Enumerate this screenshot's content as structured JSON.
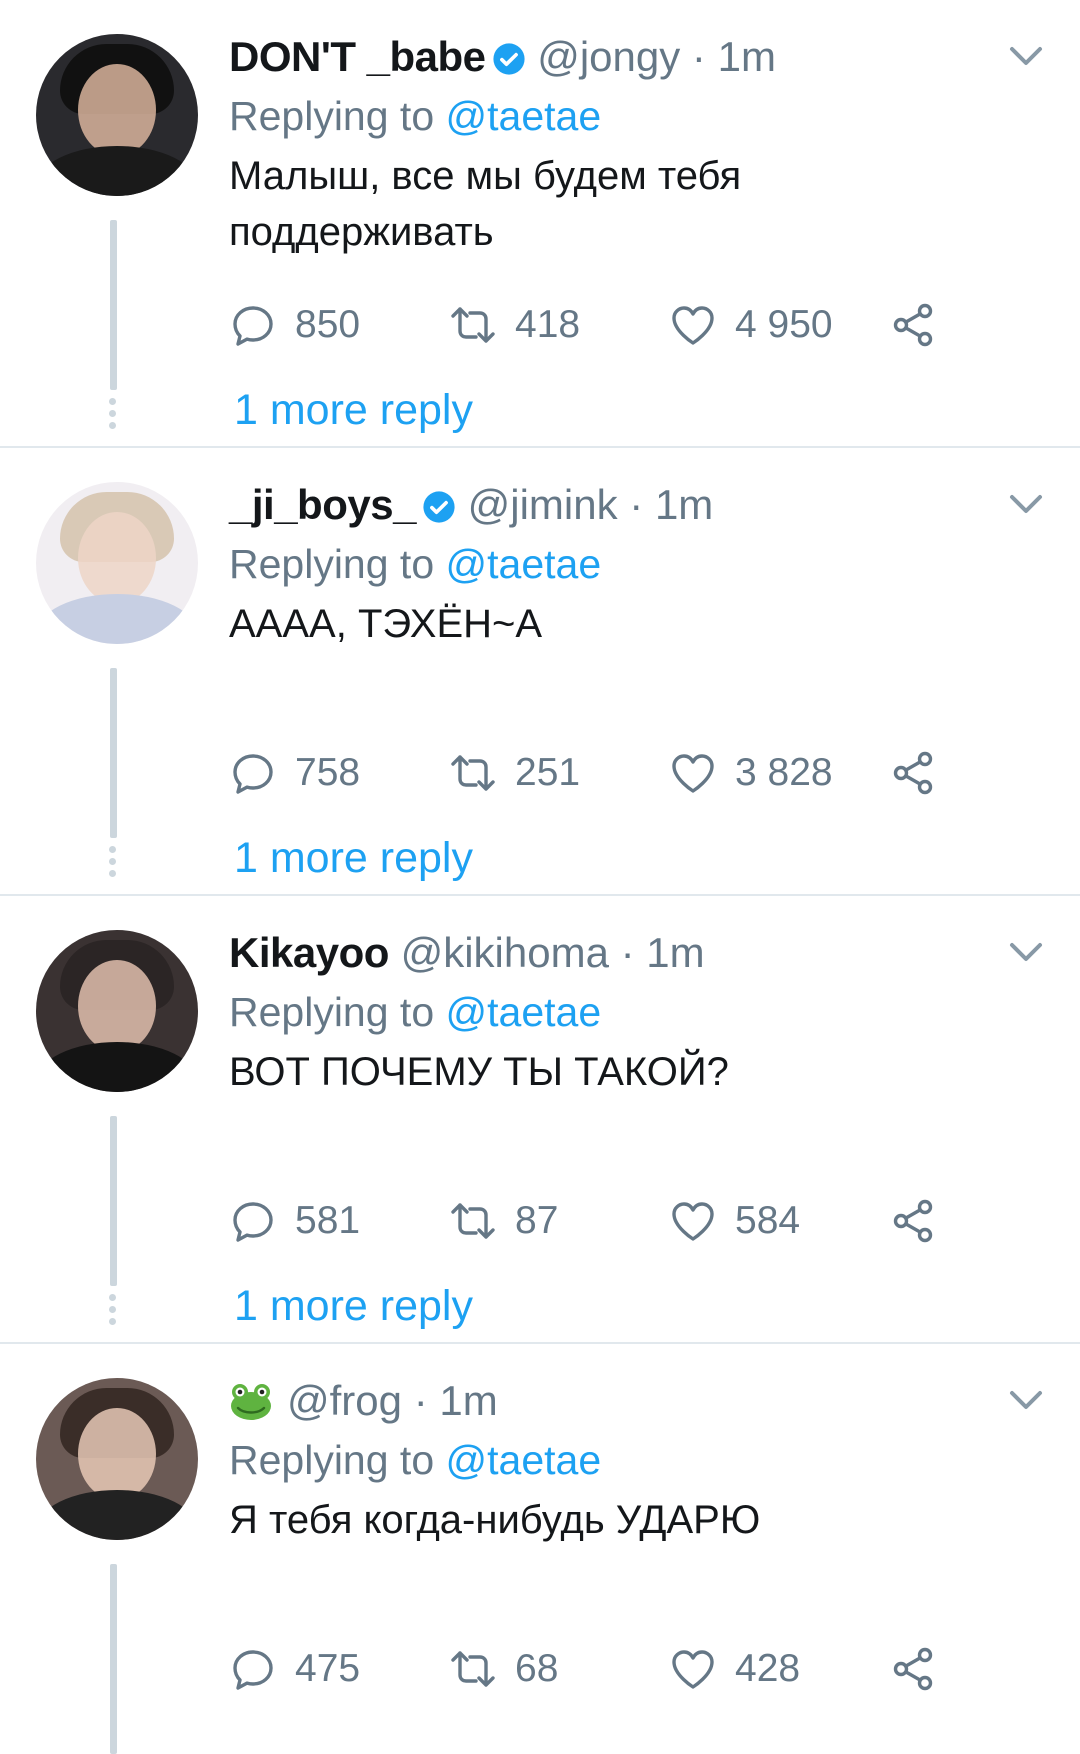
{
  "colors": {
    "accent": "#1da1f2",
    "muted": "#657786",
    "text": "#14171a",
    "divider": "#e1e8ed",
    "thread": "#ccd6dd"
  },
  "tweets": [
    {
      "name": "DON'T _babe",
      "verified": true,
      "handle": "@jongy",
      "separator": "·",
      "time": "1m",
      "replying_prefix": "Replying to",
      "replying_to": "@taetae",
      "text": "Малыш, все мы будем тебя поддерживать",
      "replies": "850",
      "retweets": "418",
      "likes": "4 950",
      "more_replies": "1 more reply"
    },
    {
      "name": "_ji_boys_",
      "verified": true,
      "handle": "@jimink",
      "separator": "·",
      "time": "1m",
      "replying_prefix": "Replying to",
      "replying_to": "@taetae",
      "text": "АААА, ТЭХЁН~А",
      "replies": "758",
      "retweets": "251",
      "likes": "3 828",
      "more_replies": "1 more reply"
    },
    {
      "name": "Kikayoo",
      "verified": false,
      "handle": "@kikihoma",
      "separator": "·",
      "time": "1m",
      "replying_prefix": "Replying to",
      "replying_to": "@taetae",
      "text": "ВОТ ПОЧЕМУ ТЫ ТАКОЙ?",
      "replies": "581",
      "retweets": "87",
      "likes": "584",
      "more_replies": "1 more reply"
    },
    {
      "name_icon": "frog-emoji-icon",
      "handle": "@frog",
      "separator": "·",
      "time": "1m",
      "replying_prefix": "Replying to",
      "replying_to": "@taetae",
      "text": "Я тебя когда-нибудь УДАРЮ",
      "replies": "475",
      "retweets": "68",
      "likes": "428"
    }
  ]
}
